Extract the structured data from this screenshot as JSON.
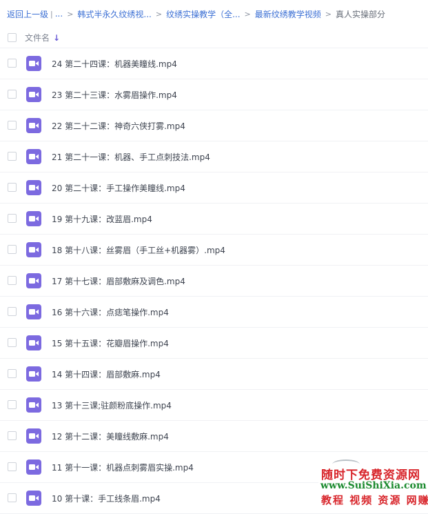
{
  "breadcrumb": {
    "back": "返回上一级",
    "ellipsis": "...",
    "items": [
      "韩式半永久纹绣视...",
      "纹绣实操教学（全...",
      "最新纹绣教学视频"
    ],
    "current": "真人实操部分"
  },
  "header": {
    "filename_label": "文件名"
  },
  "files": [
    "24 第二十四课：机器美瞳线.mp4",
    "23 第二十三课：水雾眉操作.mp4",
    "22 第二十二课：神奇六侠打雾.mp4",
    "21 第二十一课：机器、手工点刺技法.mp4",
    "20 第二十课：手工操作美瞳线.mp4",
    "19 第十九课：改蓝眉.mp4",
    "18 第十八课：丝雾眉（手工丝+机器雾）.mp4",
    "17 第十七课：眉部敷麻及调色.mp4",
    "16 第十六课：点痣笔操作.mp4",
    "15 第十五课：花瓣眉操作.mp4",
    "14 第十四课：眉部敷麻.mp4",
    "13 第十三课;驻颜粉底操作.mp4",
    "12 第十二课：美瞳线敷麻.mp4",
    "11 第十一课：机器点刺雾眉实操.mp4",
    "10 第十课：手工线条眉.mp4"
  ],
  "watermark": {
    "line1": "随时下免费资源网",
    "line2": "www.SuiShiXia.com",
    "line3": "教程 视频 资源 网赚"
  }
}
